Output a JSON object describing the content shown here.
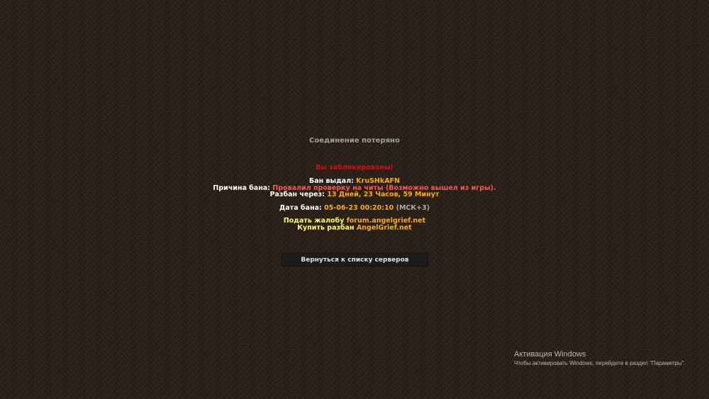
{
  "screen": {
    "title": "Соединение потеряно"
  },
  "ban_message": {
    "banned_text": "Вы заблокированы!",
    "issuer_label": "Бан выдал: ",
    "issuer_value": "KruSHkAFN",
    "reason_label": "Причина бана: ",
    "reason_value": "Провалил проверку на читы (Возможно вышел из игры).",
    "unban_label": "Разбан через: ",
    "unban_value": "13 Дней, 23 Часов, 59 Минут",
    "date_label": "Дата бана: ",
    "date_value": "05-06-23 00:20:10",
    "date_tz": " (МСК+3)",
    "appeal_label": "Подать жалобу ",
    "appeal_link": "forum.angelgrief.net",
    "buy_label": "Купить разбан ",
    "buy_link": "AngelGrief.net"
  },
  "buttons": {
    "back_label": "Вернуться к списку серверов"
  },
  "windows_activation": {
    "title": "Активация Windows",
    "text": "Чтобы активировать Windows, перейдите в раздел \"Параметры\"."
  },
  "colors": {
    "background": "#2a2119",
    "ban_red": "#c8140f",
    "gold": "#ffaa00",
    "red": "#ff5555",
    "yellow": "#ffff55",
    "gray": "#aaaaaa",
    "white": "#ffffff"
  }
}
